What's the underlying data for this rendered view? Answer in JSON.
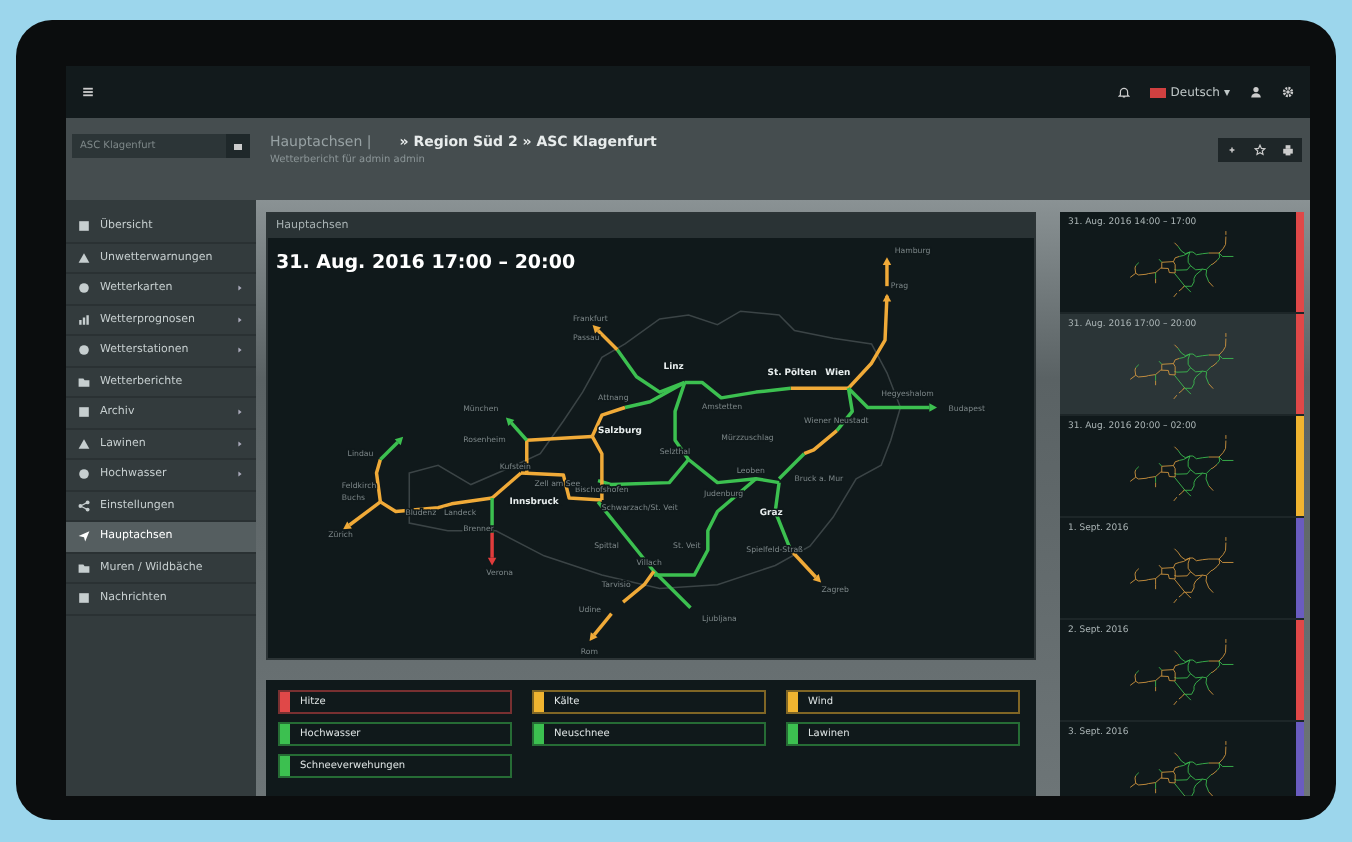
{
  "topbar": {
    "language": "Deutsch",
    "language_caret": "▾"
  },
  "search": {
    "placeholder": "ASC Klagenfurt"
  },
  "breadcrumb": {
    "first": "Hauptachsen |",
    "rest": "» Region Süd 2 » ASC Klagenfurt",
    "subtitle": "Wetterbericht für admin admin"
  },
  "sidebar": {
    "items": [
      {
        "label": "Übersicht",
        "expandable": false,
        "selected": false
      },
      {
        "label": "Unwetterwarnungen",
        "expandable": false,
        "selected": false
      },
      {
        "label": "Wetterkarten",
        "expandable": true,
        "selected": false
      },
      {
        "label": "Wetterprognosen",
        "expandable": true,
        "selected": false
      },
      {
        "label": "Wetterstationen",
        "expandable": true,
        "selected": false
      },
      {
        "label": "Wetterberichte",
        "expandable": false,
        "selected": false
      },
      {
        "label": "Archiv",
        "expandable": true,
        "selected": false
      },
      {
        "label": "Lawinen",
        "expandable": true,
        "selected": false
      },
      {
        "label": "Hochwasser",
        "expandable": true,
        "selected": false
      },
      {
        "label": "Einstellungen",
        "expandable": false,
        "selected": false
      },
      {
        "label": "Hauptachsen",
        "expandable": false,
        "selected": true
      },
      {
        "label": "Muren / Wildbäche",
        "expandable": false,
        "selected": false
      },
      {
        "label": "Nachrichten",
        "expandable": false,
        "selected": false
      }
    ]
  },
  "main_panel": {
    "header": "Hauptachsen",
    "title": "31. Aug. 2016 17:00 – 20:00",
    "cities": [
      {
        "name": "Hamburg",
        "kind": "minor"
      },
      {
        "name": "Prag",
        "kind": "minor"
      },
      {
        "name": "Frankfurt",
        "kind": "minor"
      },
      {
        "name": "Passau",
        "kind": "minor"
      },
      {
        "name": "Linz",
        "kind": "major"
      },
      {
        "name": "St. Pölten",
        "kind": "major"
      },
      {
        "name": "Wien",
        "kind": "major"
      },
      {
        "name": "Hegyeshalom",
        "kind": "minor"
      },
      {
        "name": "Amstetten",
        "kind": "minor"
      },
      {
        "name": "Budapest",
        "kind": "minor"
      },
      {
        "name": "Attnang",
        "kind": "minor"
      },
      {
        "name": "München",
        "kind": "minor"
      },
      {
        "name": "Salzburg",
        "kind": "major"
      },
      {
        "name": "Wiener Neustadt",
        "kind": "minor"
      },
      {
        "name": "Rosenheim",
        "kind": "minor"
      },
      {
        "name": "Kufstein",
        "kind": "minor"
      },
      {
        "name": "Lindau",
        "kind": "minor"
      },
      {
        "name": "Mürzzuschlag",
        "kind": "minor"
      },
      {
        "name": "Selzthal",
        "kind": "minor"
      },
      {
        "name": "Bischofshofen",
        "kind": "minor"
      },
      {
        "name": "Feldkirch",
        "kind": "minor"
      },
      {
        "name": "Buchs",
        "kind": "minor"
      },
      {
        "name": "Leoben",
        "kind": "minor"
      },
      {
        "name": "Bruck a. Mur",
        "kind": "minor"
      },
      {
        "name": "Zell am See",
        "kind": "minor"
      },
      {
        "name": "Schwarzach/St. Veit",
        "kind": "minor"
      },
      {
        "name": "Zürich",
        "kind": "minor"
      },
      {
        "name": "Bludenz",
        "kind": "minor"
      },
      {
        "name": "Landeck",
        "kind": "minor"
      },
      {
        "name": "Innsbruck",
        "kind": "major"
      },
      {
        "name": "Judenburg",
        "kind": "minor"
      },
      {
        "name": "Graz",
        "kind": "major"
      },
      {
        "name": "Brenner",
        "kind": "minor"
      },
      {
        "name": "Spittal",
        "kind": "minor"
      },
      {
        "name": "St. Veit",
        "kind": "minor"
      },
      {
        "name": "Spielfeld-Straß",
        "kind": "minor"
      },
      {
        "name": "Verona",
        "kind": "minor"
      },
      {
        "name": "Villach",
        "kind": "minor"
      },
      {
        "name": "Tarvisio",
        "kind": "minor"
      },
      {
        "name": "Zagreb",
        "kind": "minor"
      },
      {
        "name": "Udine",
        "kind": "minor"
      },
      {
        "name": "Ljubljana",
        "kind": "minor"
      },
      {
        "name": "Rom",
        "kind": "minor"
      }
    ]
  },
  "legend": [
    {
      "label": "Hitze",
      "color": "#e04848"
    },
    {
      "label": "Kälte",
      "color": "#f0b430"
    },
    {
      "label": "Wind",
      "color": "#f0b430"
    },
    {
      "label": "Hochwasser",
      "color": "#3cc050"
    },
    {
      "label": "Neuschnee",
      "color": "#3cc050"
    },
    {
      "label": "Lawinen",
      "color": "#3cc050"
    },
    {
      "label": "Schneeverwehungen",
      "color": "#3cc050"
    }
  ],
  "timeline": [
    {
      "label": "31. Aug. 2016 14:00 – 17:00",
      "color": "#e04848",
      "selected": false
    },
    {
      "label": "31. Aug. 2016 17:00 – 20:00",
      "color": "#e04848",
      "selected": true
    },
    {
      "label": "31. Aug. 2016 20:00 – 02:00",
      "color": "#f0b430",
      "selected": false
    },
    {
      "label": "1. Sept. 2016",
      "color": "#6a5cc0",
      "selected": false
    },
    {
      "label": "2. Sept. 2016",
      "color": "#e04848",
      "selected": false
    },
    {
      "label": "3. Sept. 2016",
      "color": "#6a5cc0",
      "selected": false
    }
  ]
}
